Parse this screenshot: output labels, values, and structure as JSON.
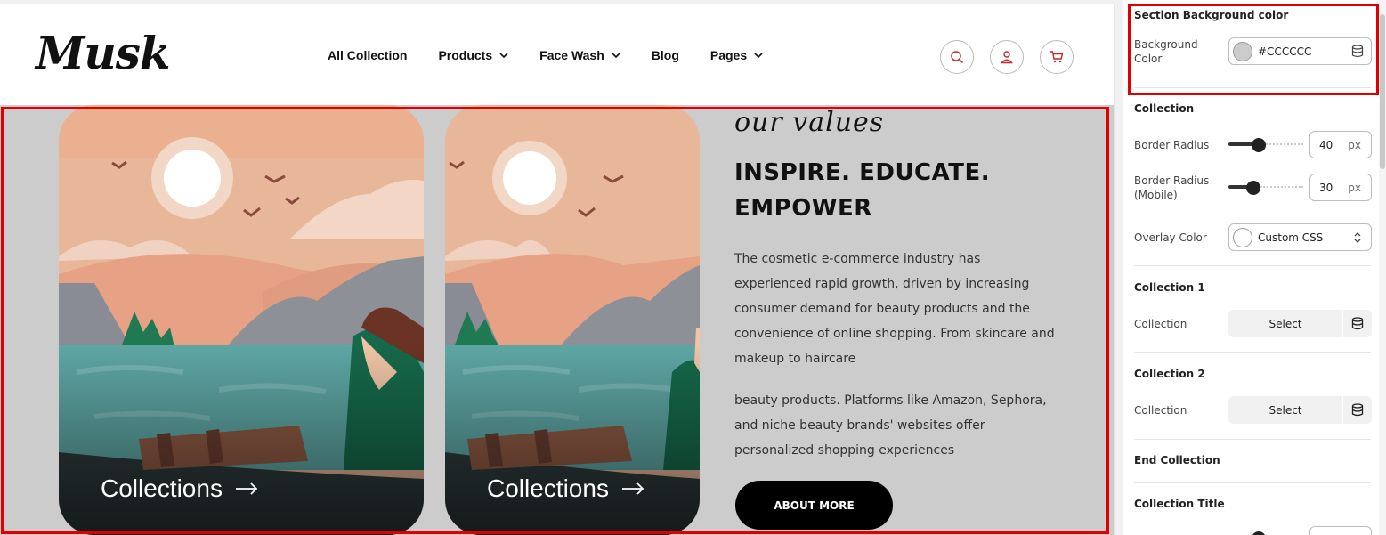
{
  "brand": {
    "logo_text": "Musk"
  },
  "nav": {
    "items": [
      {
        "label": "All Collection",
        "has_dropdown": false
      },
      {
        "label": "Products",
        "has_dropdown": true
      },
      {
        "label": "Face Wash",
        "has_dropdown": true
      },
      {
        "label": "Blog",
        "has_dropdown": false
      },
      {
        "label": "Pages",
        "has_dropdown": true
      }
    ],
    "icons": [
      "search-icon",
      "user-icon",
      "cart-icon"
    ],
    "icon_color": "#c62828"
  },
  "section": {
    "background": "#cccccc",
    "cards": [
      {
        "caption": "Collections"
      },
      {
        "caption": "Collections"
      }
    ],
    "script_title": "our values",
    "headline": "INSPIRE. EDUCATE. EMPOWER",
    "paragraph_1": "The cosmetic e-commerce industry has experienced rapid growth, driven by increasing consumer demand for beauty products and the convenience of online shopping. From skincare and makeup to haircare",
    "paragraph_2": "beauty products. Platforms like Amazon, Sephora, and niche beauty brands' websites offer personalized shopping experiences",
    "button_label": "ABOUT MORE"
  },
  "settings": {
    "bg_section_title": "Section Background color",
    "bg_color_label": "Background Color",
    "bg_color_value": "#CCCCCC",
    "collection_title": "Collection",
    "border_radius_label": "Border Radius",
    "border_radius_value": "40",
    "border_radius_mobile_label": "Border Radius (Mobile)",
    "border_radius_mobile_value": "30",
    "unit": "px",
    "overlay_label": "Overlay Color",
    "overlay_value": "Custom CSS",
    "collection1_title": "Collection 1",
    "collection1_label": "Collection",
    "collection1_button": "Select",
    "collection2_title": "Collection 2",
    "collection2_label": "Collection",
    "collection2_button": "Select",
    "end_collection": "End Collection",
    "collection_title_heading": "Collection Title"
  },
  "highlight_color": "#e00000"
}
